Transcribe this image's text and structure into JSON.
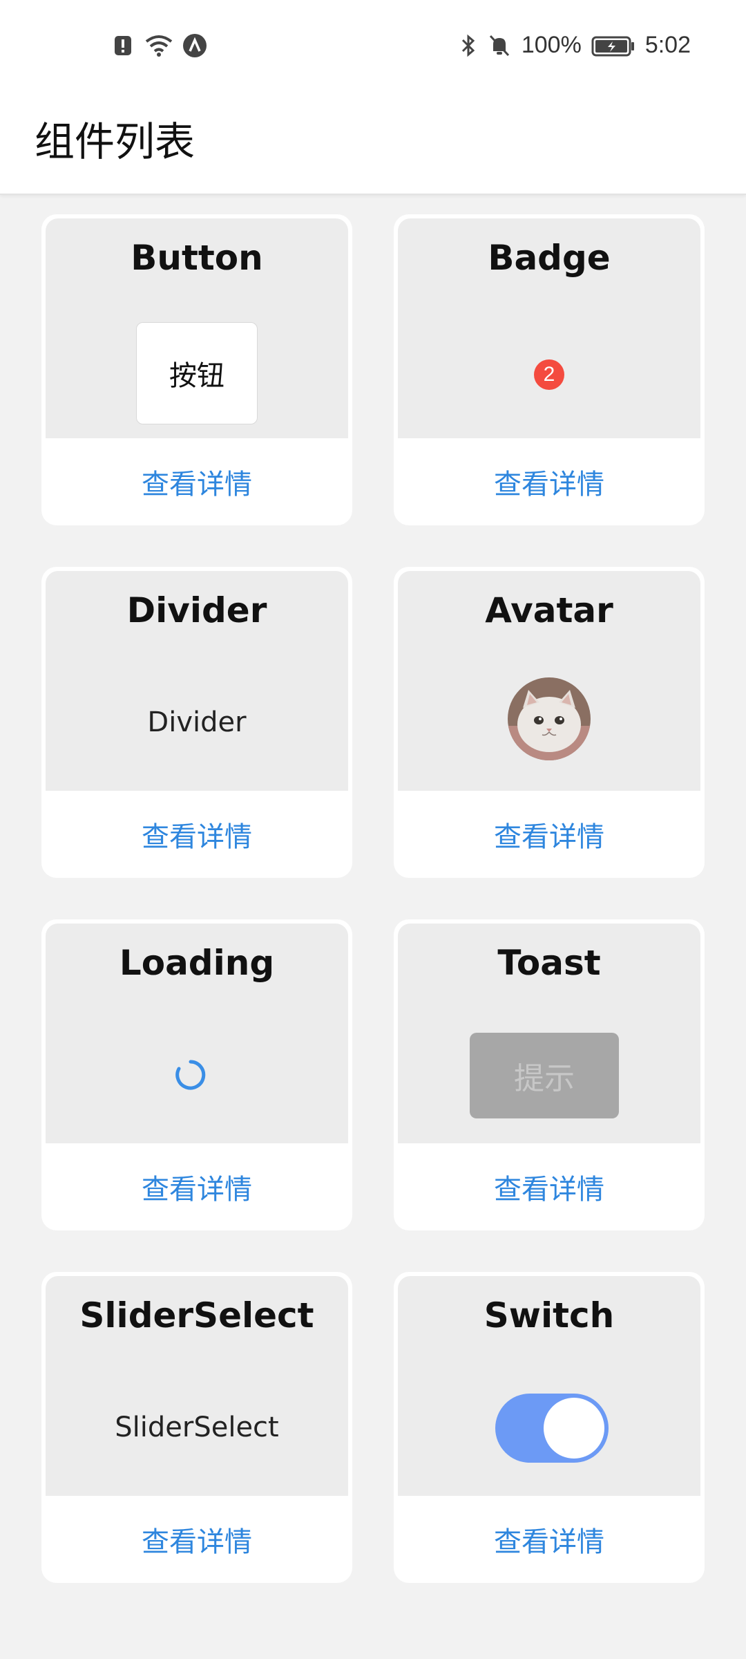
{
  "status_bar": {
    "battery_percent": "100%",
    "time": "5:02",
    "icons_left": [
      "alert-icon",
      "wifi-icon",
      "vpn-icon"
    ],
    "icons_right": [
      "bluetooth-icon",
      "mute-icon",
      "battery-icon"
    ]
  },
  "header": {
    "title": "组件列表"
  },
  "cards": [
    {
      "title": "Button",
      "detail": "查看详情",
      "demo_label": "按钮"
    },
    {
      "title": "Badge",
      "detail": "查看详情",
      "badge_value": "2"
    },
    {
      "title": "Divider",
      "detail": "查看详情",
      "demo_text": "Divider"
    },
    {
      "title": "Avatar",
      "detail": "查看详情"
    },
    {
      "title": "Loading",
      "detail": "查看详情"
    },
    {
      "title": "Toast",
      "detail": "查看详情",
      "demo_label": "提示"
    },
    {
      "title": "SliderSelect",
      "detail": "查看详情",
      "demo_text": "SliderSelect"
    },
    {
      "title": "Switch",
      "detail": "查看详情",
      "switch_on": true
    }
  ],
  "colors": {
    "link": "#2e86de",
    "badge": "#f44b3f",
    "switch_on": "#6c9af5",
    "spinner": "#3a8ee6"
  }
}
